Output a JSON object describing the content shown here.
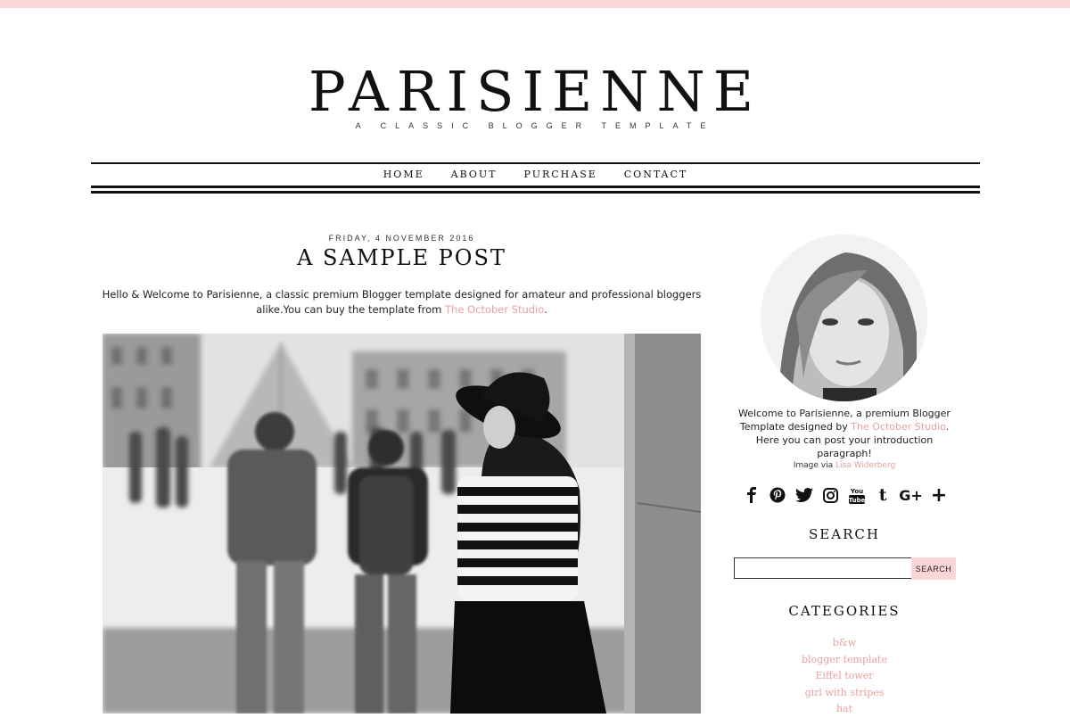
{
  "header": {
    "title": "PARISIENNE",
    "tagline": "A CLASSIC BLOGGER TEMPLATE"
  },
  "nav": {
    "items": [
      {
        "label": "HOME"
      },
      {
        "label": "ABOUT"
      },
      {
        "label": "PURCHASE"
      },
      {
        "label": "CONTACT"
      }
    ]
  },
  "post": {
    "date": "FRIDAY, 4 NOVEMBER 2016",
    "title": "A SAMPLE POST",
    "body_line1": "Hello & Welcome to Parisienne, a classic premium Blogger template designed for amateur and professional bloggers",
    "body_line2_prefix": "alike.You can buy the template from ",
    "body_link": "The October Studio",
    "body_suffix": "."
  },
  "sidebar": {
    "intro_prefix": "Welcome to Parisienne, a premium Blogger Template designed by ",
    "intro_link": "The October Studio",
    "intro_suffix": ". Here you can post your introduction paragraph!",
    "credit_prefix": "Image via ",
    "credit_link": "Lisa Widerberg",
    "social": [
      {
        "icon": "facebook-icon"
      },
      {
        "icon": "pinterest-icon"
      },
      {
        "icon": "twitter-icon"
      },
      {
        "icon": "instagram-icon"
      },
      {
        "icon": "youtube-icon",
        "text": "You Tube"
      },
      {
        "icon": "tumblr-icon",
        "text": "t"
      },
      {
        "icon": "google-plus-icon",
        "text": "G+"
      },
      {
        "icon": "bloglovin-icon",
        "text": "+"
      }
    ],
    "search_title": "SEARCH",
    "search_value": "",
    "search_button": "SEARCH",
    "categories_title": "CATEGORIES",
    "categories": [
      {
        "label": "b&w"
      },
      {
        "label": "blogger template"
      },
      {
        "label": "Eiffel tower"
      },
      {
        "label": "girl with stripes"
      },
      {
        "label": "hat"
      }
    ]
  },
  "colors": {
    "accent_pink": "#fcd6d6",
    "link_pink": "#e9a0a0",
    "text_dark": "#111111"
  }
}
